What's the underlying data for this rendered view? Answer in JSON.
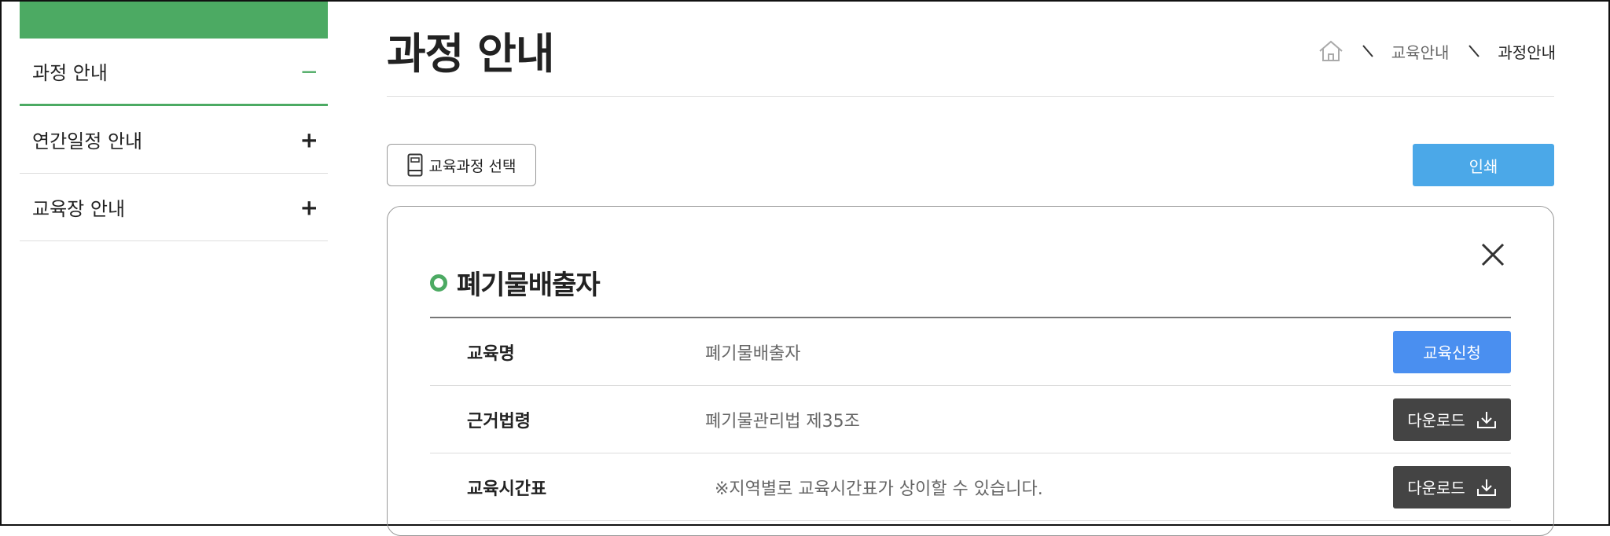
{
  "sidebar": {
    "items": [
      {
        "label": "과정 안내",
        "toggle": "−"
      },
      {
        "label": "연간일정 안내",
        "toggle": "+"
      },
      {
        "label": "교육장 안내",
        "toggle": "+"
      }
    ]
  },
  "header": {
    "title": "과정 안내",
    "breadcrumb": {
      "level1": "교육안내",
      "level2": "과정안내"
    }
  },
  "toolbar": {
    "course_select_label": "교육과정 선택",
    "print_label": "인쇄"
  },
  "course": {
    "title": "폐기물배출자",
    "rows": [
      {
        "label": "교육명",
        "value": "폐기물배출자",
        "button": "교육신청"
      },
      {
        "label": "근거법령",
        "value": "폐기물관리법 제35조",
        "button": "다운로드"
      },
      {
        "label": "교육시간표",
        "value": "※지역별로 교육시간표가 상이할 수 있습니다.",
        "button": "다운로드"
      }
    ]
  },
  "colors": {
    "accent_green": "#4caa63",
    "print_blue": "#4ba8e8",
    "apply_blue": "#4a8ff0",
    "download_dark": "#444444"
  },
  "icons": {
    "home": "home-icon",
    "book": "book-icon",
    "close": "close-icon",
    "download": "download-icon"
  }
}
